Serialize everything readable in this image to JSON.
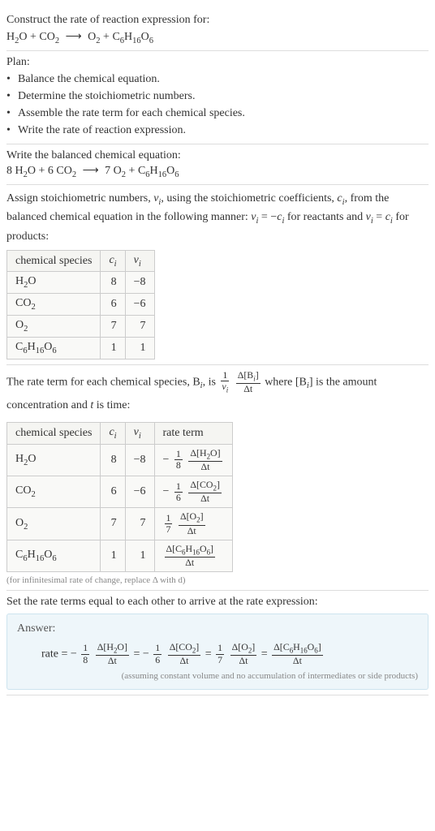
{
  "chart_data": {
    "type": "table",
    "tables": [
      {
        "title": "Stoichiometric numbers",
        "columns": [
          "chemical species",
          "c_i",
          "ν_i"
        ],
        "rows": [
          [
            "H2O",
            8,
            -8
          ],
          [
            "CO2",
            6,
            -6
          ],
          [
            "O2",
            7,
            7
          ],
          [
            "C6H16O6",
            1,
            1
          ]
        ]
      },
      {
        "title": "Rate terms",
        "columns": [
          "chemical species",
          "c_i",
          "ν_i",
          "rate term"
        ],
        "rows": [
          [
            "H2O",
            8,
            -8,
            "-1/8 Δ[H2O]/Δt"
          ],
          [
            "CO2",
            6,
            -6,
            "-1/6 Δ[CO2]/Δt"
          ],
          [
            "O2",
            7,
            7,
            "1/7 Δ[O2]/Δt"
          ],
          [
            "C6H16O6",
            1,
            1,
            "Δ[C6H16O6]/Δt"
          ]
        ]
      }
    ]
  },
  "prompt": {
    "heading": "Construct the rate of reaction expression for:",
    "equation_lhs_1": "H",
    "equation_lhs_1_sub": "2",
    "equation_lhs_1_suffix": "O + CO",
    "equation_lhs_2_sub": "2",
    "equation_arrow": "⟶",
    "equation_rhs_1": "O",
    "equation_rhs_1_sub": "2",
    "equation_rhs_2": " + C",
    "equation_rhs_2_sub": "6",
    "equation_rhs_3": "H",
    "equation_rhs_3_sub": "16",
    "equation_rhs_4": "O",
    "equation_rhs_4_sub": "6"
  },
  "plan": {
    "heading": "Plan:",
    "items": [
      "Balance the chemical equation.",
      "Determine the stoichiometric numbers.",
      "Assemble the rate term for each chemical species.",
      "Write the rate of reaction expression."
    ]
  },
  "balanced": {
    "heading": "Write the balanced chemical equation:",
    "eq_text_1": "8 H",
    "eq_text_2": "O + 6 CO",
    "eq_text_3": "7 O",
    "eq_text_4": " + C",
    "sub2": "2",
    "sub6": "6",
    "sub16": "16",
    "arrow": "⟶"
  },
  "stoich": {
    "text_1": "Assign stoichiometric numbers, ",
    "nu_i": "ν",
    "sub_i": "i",
    "text_2": ", using the stoichiometric coefficients, ",
    "c_i": "c",
    "text_3": ", from the balanced chemical equation in the following manner: ",
    "eq1": " = −",
    "text_4": " for reactants and ",
    "eq2": " = ",
    "text_5": " for products:",
    "headers": {
      "species": "chemical species",
      "ci": "c",
      "nui": "ν"
    },
    "rows": [
      {
        "species_1": "H",
        "species_sub1": "2",
        "species_2": "O",
        "ci": "8",
        "nui": "−8"
      },
      {
        "species_1": "CO",
        "species_sub1": "2",
        "species_2": "",
        "ci": "6",
        "nui": "−6"
      },
      {
        "species_1": "O",
        "species_sub1": "2",
        "species_2": "",
        "ci": "7",
        "nui": "7"
      },
      {
        "species_1": "C",
        "species_sub1": "6",
        "species_2": "H",
        "species_sub2": "16",
        "species_3": "O",
        "species_sub3": "6",
        "ci": "1",
        "nui": "1"
      }
    ]
  },
  "rate_term": {
    "text_1": "The rate term for each chemical species, B",
    "text_2": ", is ",
    "frac1_num": "1",
    "frac1_den_nu": "ν",
    "frac2_num_delta": "Δ[B",
    "frac2_num_close": "]",
    "frac2_den": "Δt",
    "text_3": " where [B",
    "text_4": "] is the amount concentration and ",
    "t_var": "t",
    "text_5": " is time:",
    "headers": {
      "species": "chemical species",
      "ci": "c",
      "nui": "ν",
      "rate": "rate term"
    },
    "rows": [
      {
        "species": "H2O",
        "ci": "8",
        "nui": "−8",
        "rate_prefix": "−",
        "rate_frac1_num": "1",
        "rate_frac1_den": "8",
        "rate_frac2_num": "Δ[H2O]",
        "rate_frac2_den": "Δt"
      },
      {
        "species": "CO2",
        "ci": "6",
        "nui": "−6",
        "rate_prefix": "−",
        "rate_frac1_num": "1",
        "rate_frac1_den": "6",
        "rate_frac2_num": "Δ[CO2]",
        "rate_frac2_den": "Δt"
      },
      {
        "species": "O2",
        "ci": "7",
        "nui": "7",
        "rate_prefix": "",
        "rate_frac1_num": "1",
        "rate_frac1_den": "7",
        "rate_frac2_num": "Δ[O2]",
        "rate_frac2_den": "Δt"
      },
      {
        "species": "C6H16O6",
        "ci": "1",
        "nui": "1",
        "rate_prefix": "",
        "rate_frac1_num": "",
        "rate_frac1_den": "",
        "rate_frac2_num": "Δ[C6H16O6]",
        "rate_frac2_den": "Δt"
      }
    ],
    "footnote": "(for infinitesimal rate of change, replace Δ with d)"
  },
  "final": {
    "heading": "Set the rate terms equal to each other to arrive at the rate expression:"
  },
  "answer": {
    "label": "Answer:",
    "rate_label": "rate = ",
    "minus": "−",
    "one": "1",
    "eight": "8",
    "six": "6",
    "seven": "7",
    "dH2O": "Δ[H2O]",
    "dCO2": "Δ[CO2]",
    "dO2": "Δ[O2]",
    "dC6": "Δ[C6H16O6]",
    "dt": "Δt",
    "eq": " = ",
    "note": "(assuming constant volume and no accumulation of intermediates or side products)"
  },
  "i_sub": "i",
  "sub2": "2",
  "sub6": "6",
  "sub16": "16"
}
